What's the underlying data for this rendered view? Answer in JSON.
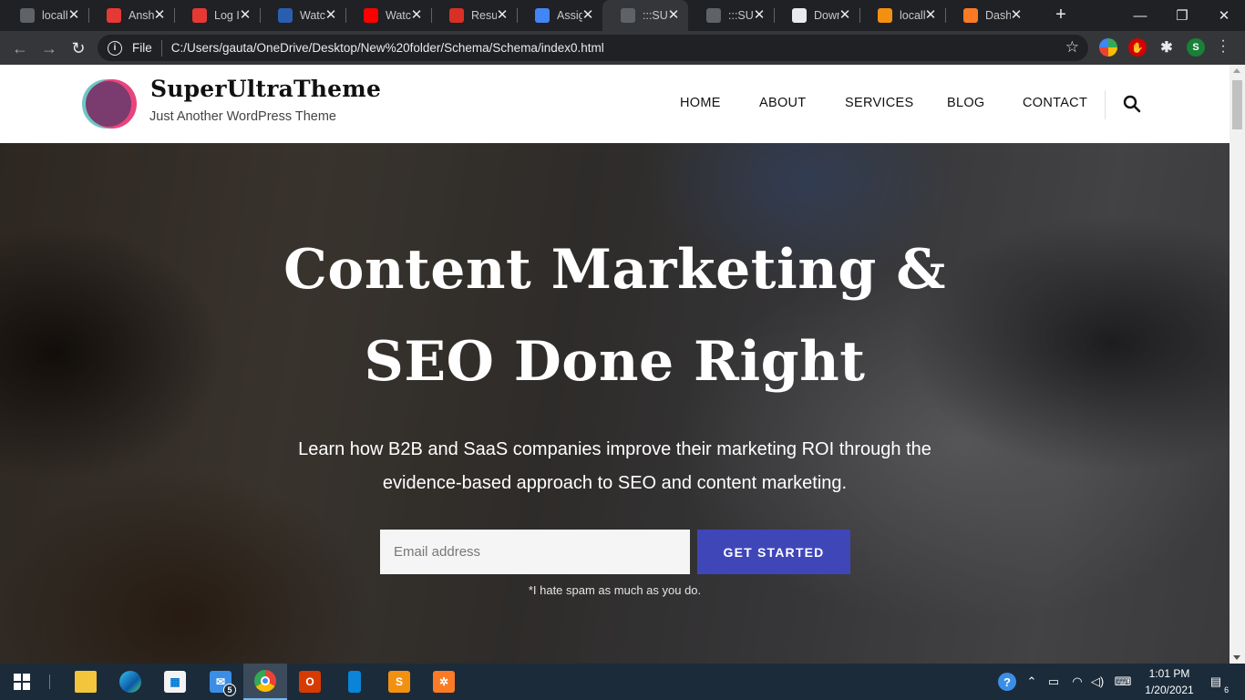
{
  "browser": {
    "tabs": [
      {
        "title": "localh",
        "favicon": "globe-icon",
        "color": "#5f6368"
      },
      {
        "title": "Anshu",
        "favicon": "site-logo-icon",
        "color": "#e53935"
      },
      {
        "title": "Log Ir",
        "favicon": "site-logo-icon",
        "color": "#e53935"
      },
      {
        "title": "Watcl",
        "favicon": "stream-icon",
        "color": "#2a5fb0"
      },
      {
        "title": "Watcl",
        "favicon": "youtube-icon",
        "color": "#ff0000"
      },
      {
        "title": "Resun",
        "favicon": "gmail-icon",
        "color": "#d93025"
      },
      {
        "title": "Assig",
        "favicon": "docs-icon",
        "color": "#4285f4"
      },
      {
        "title": ":::SUP",
        "favicon": "globe-icon",
        "color": "#5f6368"
      },
      {
        "title": ":::SUP",
        "favicon": "globe-icon",
        "color": "#5f6368"
      },
      {
        "title": "Down",
        "favicon": "wordpress-icon",
        "color": "#e8eaed"
      },
      {
        "title": "localh",
        "favicon": "phpmyadmin-icon",
        "color": "#f29111"
      },
      {
        "title": "Dashl",
        "favicon": "xampp-icon",
        "color": "#fb7a24"
      }
    ],
    "active_tab": 7,
    "tab_close_glyph": "✕",
    "new_tab_glyph": "+",
    "window_controls": {
      "minimize": "—",
      "restore": "❐",
      "close": "✕"
    },
    "nav": {
      "back": "←",
      "forward": "→",
      "reload": "↻"
    },
    "address": {
      "info_glyph": "i",
      "scheme_label": "File",
      "url": "C:/Users/gauta/OneDrive/Desktop/New%20folder/Schema/Schema/index0.html",
      "star_glyph": "☆"
    },
    "profile_initial": "S"
  },
  "site": {
    "title": "SuperUltraTheme",
    "tagline": "Just Another WordPress Theme",
    "nav": [
      "HOME",
      "ABOUT",
      "SERVICES",
      "BLOG",
      "CONTACT"
    ]
  },
  "hero": {
    "title_line1": "Content Marketing &",
    "title_line2": "SEO Done Right",
    "sub_line1": "Learn how B2B and SaaS companies improve their marketing ROI through the",
    "sub_line2": "evidence-based approach to SEO and content marketing.",
    "email_placeholder": "Email address",
    "cta_label": "GET STARTED",
    "spam_note": "*I hate spam as much as you do."
  },
  "taskbar": {
    "mail_badge": "5",
    "clock_time": "1:01 PM",
    "clock_date": "1/20/2021",
    "notification_count": "6",
    "help_glyph": "?"
  },
  "colors": {
    "accent": "#3f46b8",
    "taskbar": "#1b2b3a",
    "browser_dark": "#202124"
  }
}
